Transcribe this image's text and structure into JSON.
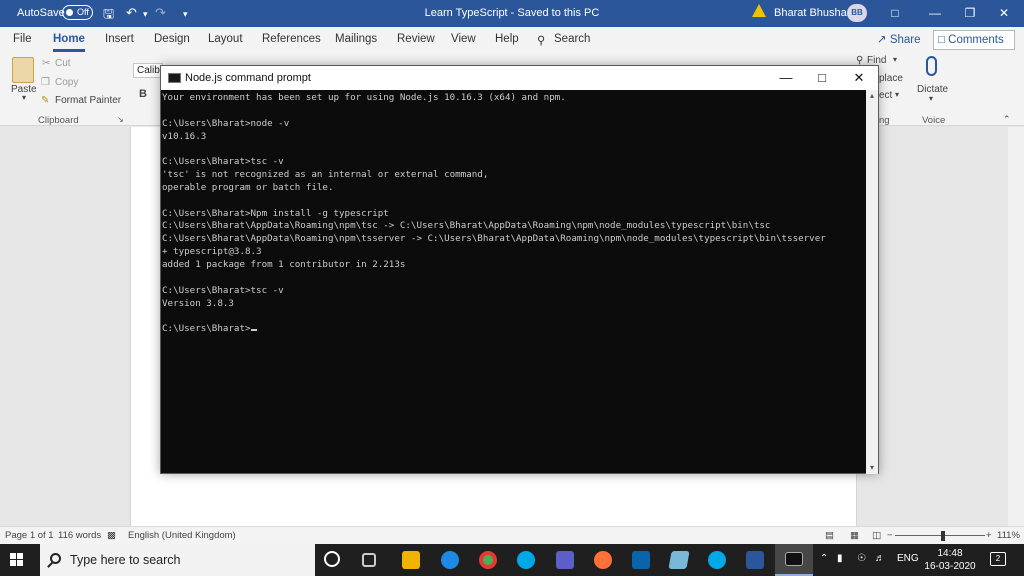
{
  "word": {
    "autosave_label": "AutoSave",
    "autosave_state": "Off",
    "document_title": "Learn TypeScript  -  Saved to this PC",
    "user_name": "Bharat Bhushan",
    "user_initials": "BB",
    "tabs": [
      "File",
      "Home",
      "Insert",
      "Design",
      "Layout",
      "References",
      "Mailings",
      "Review",
      "View",
      "Help"
    ],
    "active_tab": "Home",
    "search_label": "Search",
    "share_label": "Share",
    "comments_label": "Comments",
    "clipboard": {
      "paste": "Paste",
      "cut": "Cut",
      "copy": "Copy",
      "format_painter": "Format Painter",
      "group": "Clipboard"
    },
    "font_box": "Calibri",
    "bold": "B",
    "editing": {
      "find": "Find",
      "replace": "place",
      "select": "ect",
      "group": "ng"
    },
    "voice": {
      "dictate": "Dictate",
      "group": "Voice"
    },
    "status": {
      "page": "Page 1 of 1",
      "words": "116 words",
      "language": "English (United Kingdom)",
      "zoom": "111%"
    }
  },
  "cmd": {
    "title": "Node.js command prompt",
    "lines": [
      "Your environment has been set up for using Node.js 10.16.3 (x64) and npm.",
      "",
      "C:\\Users\\Bharat>node -v",
      "v10.16.3",
      "",
      "C:\\Users\\Bharat>tsc -v",
      "'tsc' is not recognized as an internal or external command,",
      "operable program or batch file.",
      "",
      "C:\\Users\\Bharat>Npm install -g typescript",
      "C:\\Users\\Bharat\\AppData\\Roaming\\npm\\tsc -> C:\\Users\\Bharat\\AppData\\Roaming\\npm\\node_modules\\typescript\\bin\\tsc",
      "C:\\Users\\Bharat\\AppData\\Roaming\\npm\\tsserver -> C:\\Users\\Bharat\\AppData\\Roaming\\npm\\node_modules\\typescript\\bin\\tsserver",
      "+ typescript@3.8.3",
      "added 1 package from 1 contributor in 2.213s",
      "",
      "C:\\Users\\Bharat>tsc -v",
      "Version 3.8.3",
      "",
      "C:\\Users\\Bharat>"
    ]
  },
  "taskbar": {
    "search_placeholder": "Type here to search",
    "language": "ENG",
    "time": "14:48",
    "date": "16-03-2020",
    "notifications": "2",
    "pinned_icons": [
      "task-view-icon",
      "file-explorer-icon",
      "edge-icon",
      "chrome-icon",
      "skype-icon",
      "teams-icon",
      "firefox-icon",
      "outlook-icon",
      "notepad-icon",
      "skype-blue-icon",
      "word-icon",
      "cmd-icon"
    ],
    "colors": {
      "explorer": "#f0b400",
      "edge": "#1e88e5",
      "chrome": "#4caf50",
      "skype": "#00a8e8",
      "teams": "#5b5fc7",
      "firefox": "#ff7139",
      "outlook": "#0a64ad",
      "word": "#2b579a"
    }
  }
}
